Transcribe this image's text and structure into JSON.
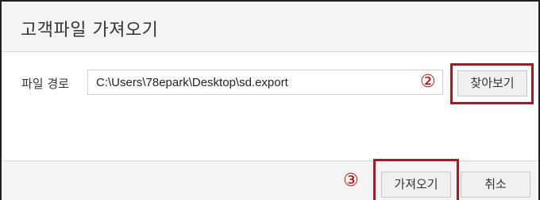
{
  "dialog": {
    "title": "고객파일 가져오기"
  },
  "form": {
    "path_label": "파일 경로",
    "path_value": "C:\\Users\\78epark\\Desktop\\sd.export",
    "browse_label": "찾아보기",
    "browse_marker": "②"
  },
  "footer": {
    "import_label": "가져오기",
    "cancel_label": "취소",
    "import_marker": "③"
  },
  "colors": {
    "highlight": "#b0161d",
    "marker": "#c00000"
  }
}
